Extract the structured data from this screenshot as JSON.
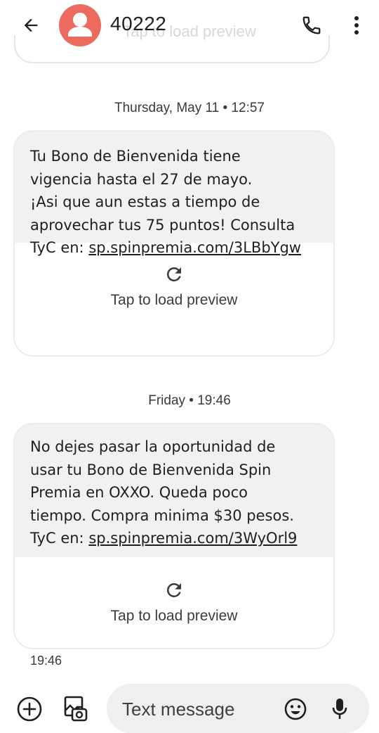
{
  "header": {
    "title": "40222",
    "ghost_preview_text": "Tap to load preview"
  },
  "messages": [
    {
      "date_separator": "Thursday, May 11 • 12:57",
      "lines": [
        "Tu Bono de Bienvenida tiene",
        "vigencia hasta el 27 de mayo.",
        "¡Asi que aun estas a tiempo de",
        "aprovechar tus 75 puntos! Consulta"
      ],
      "link_prefix": "TyC en: ",
      "link_text": "sp.spinpremia.com/3LBbYgw",
      "preview_label": "Tap to load preview"
    },
    {
      "date_separator": "Friday • 19:46",
      "lines": [
        "No dejes pasar la oportunidad de",
        "usar tu Bono de Bienvenida Spin",
        "Premia en OXXO. Queda poco",
        "tiempo. Compra minima $30 pesos."
      ],
      "link_prefix": "TyC en: ",
      "link_text": "sp.spinpremia.com/3WyOrl9",
      "preview_label": "Tap to load preview",
      "time": "19:46"
    }
  ],
  "composer": {
    "placeholder": "Text message"
  },
  "colors": {
    "avatar": "#ec6a5e",
    "bubble": "#f1f1f1",
    "composer_pill": "#efefef"
  },
  "icons": [
    "back-arrow-icon",
    "avatar-person-icon",
    "phone-icon",
    "more-vert-icon",
    "reload-icon",
    "add-icon",
    "gallery-icon",
    "emoji-icon",
    "mic-icon"
  ]
}
